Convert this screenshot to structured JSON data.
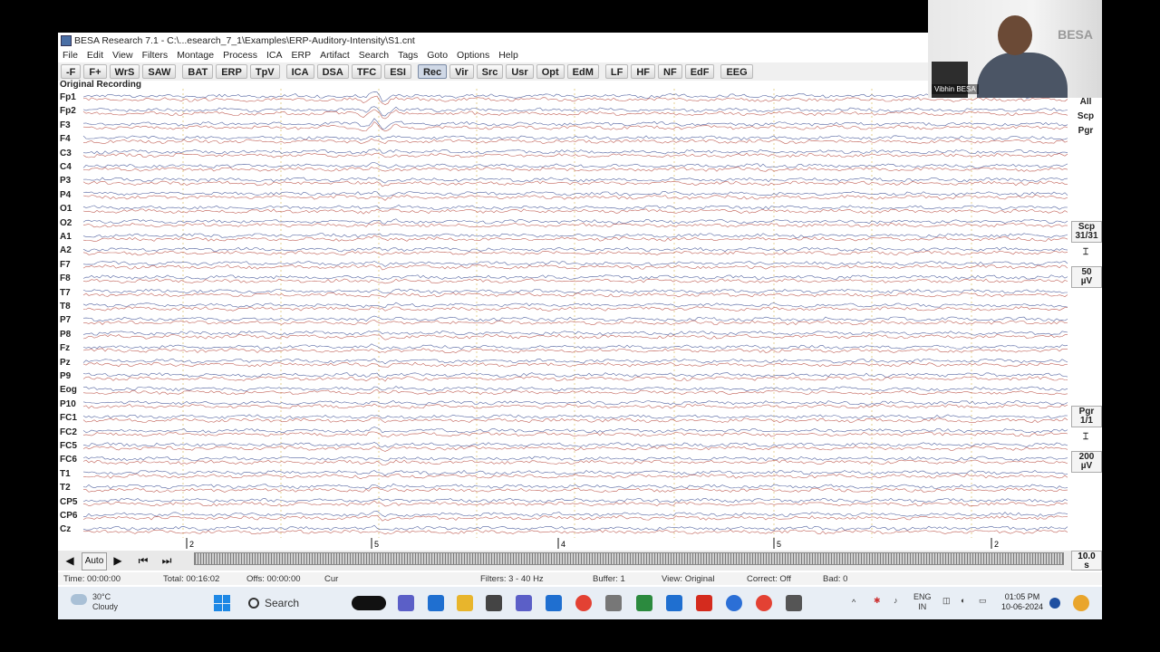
{
  "window": {
    "title": "BESA Research 7.1 - C:\\...esearch_7_1\\Examples\\ERP-Auditory-Intensity\\S1.cnt"
  },
  "menu": [
    "File",
    "Edit",
    "View",
    "Filters",
    "Montage",
    "Process",
    "ICA",
    "ERP",
    "Artifact",
    "Search",
    "Tags",
    "Goto",
    "Options",
    "Help"
  ],
  "toolbar": {
    "buttons": [
      "-F",
      "F+",
      "WrS",
      "SAW",
      "BAT",
      "ERP",
      "TpV",
      "ICA",
      "DSA",
      "TFC",
      "ESI",
      "Rec",
      "Vir",
      "Src",
      "Usr",
      "Opt",
      "EdM",
      "LF",
      "HF",
      "NF",
      "EdF",
      "EEG"
    ],
    "active": "Rec"
  },
  "recording_label": "Original Recording",
  "channels": [
    "Fp1",
    "Fp2",
    "F3",
    "F4",
    "C3",
    "C4",
    "P3",
    "P4",
    "O1",
    "O2",
    "A1",
    "A2",
    "F7",
    "F8",
    "T7",
    "T8",
    "P7",
    "P8",
    "Fz",
    "Pz",
    "P9",
    "Eog",
    "P10",
    "FC1",
    "FC2",
    "FC5",
    "FC6",
    "T1",
    "T2",
    "CP5",
    "CP6",
    "Cz"
  ],
  "right_panel": {
    "all": "All",
    "scp": "Scp",
    "pgr": "Pgr",
    "scp_box": "Scp",
    "scp_count": "31/31",
    "scale1_value": "50",
    "scale1_unit": "µV",
    "pgr_box": "Pgr",
    "pgr_count": "1/1",
    "scale2_value": "200",
    "scale2_unit": "µV"
  },
  "timeline_markers": [
    "2",
    "5",
    "4",
    "5",
    "2"
  ],
  "nav": {
    "auto": "Auto",
    "page_length_value": "10.0",
    "page_length_unit": "s",
    "prev_icon": "triangle-left-icon",
    "next_icon": "triangle-right-icon"
  },
  "status": {
    "time": "Time: 00:00:00",
    "total": "Total: 00:16:02",
    "offs": "Offs: 00:00:00",
    "cur": "Cur",
    "filters": "Filters: 3 - 40 Hz",
    "buffer": "Buffer: 1",
    "view": "View: Original",
    "correct": "Correct: Off",
    "bad": "Bad: 0"
  },
  "taskbar": {
    "weather_temp": "30°C",
    "weather_desc": "Cloudy",
    "search": "Search",
    "lang1": "ENG",
    "lang2": "IN",
    "time": "01:05 PM",
    "date": "10-06-2024"
  },
  "webcam": {
    "name": "Vibhin BESA",
    "brand": "BESA"
  },
  "colors": {
    "trace_blue": "#2b3f8a",
    "trace_red": "#b23a2e",
    "grid_gold": "#d2b24a",
    "active_button": "#cfd8e6"
  }
}
